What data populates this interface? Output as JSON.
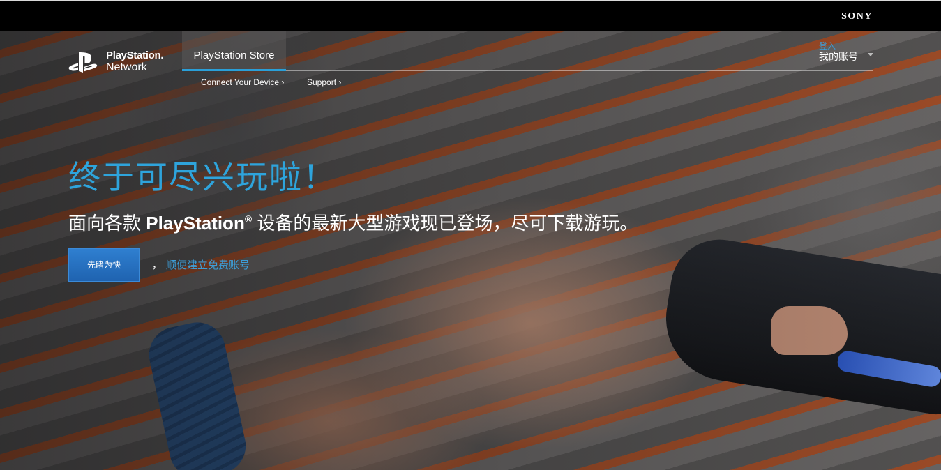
{
  "sony_bar": {
    "logo": "SONY"
  },
  "header": {
    "logo": {
      "line1": "PlayStation.",
      "line2": "Network",
      "icon": "playstation-icon"
    },
    "store_tab": "PlayStation Store",
    "subnav": {
      "connect": "Connect Your Device ›",
      "support": "Support ›"
    },
    "account": {
      "signin": "登入",
      "label": "我的账号",
      "icon": "chevron-down-icon"
    }
  },
  "hero": {
    "headline": "终于可尽兴玩啦！",
    "tagline": {
      "prefix": "面向各款 ",
      "brand": "PlayStation",
      "reg": "®",
      "suffix": " 设备的最新大型游戏现已登场，尽可下载游玩。"
    },
    "cta_button": "先睹为快",
    "comma": "，",
    "signup_link": "顺便建立免费账号"
  },
  "colors": {
    "accent": "#2ea4dc",
    "button": "#1f63b0",
    "link": "#3d9ed8"
  }
}
